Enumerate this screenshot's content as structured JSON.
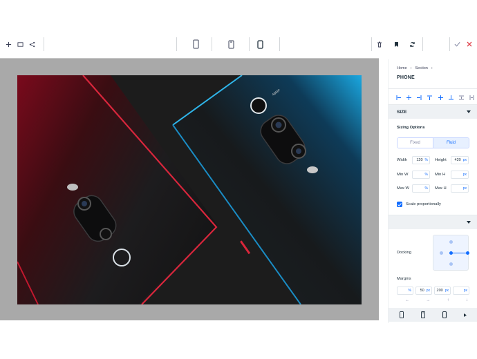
{
  "toolbar": {
    "left_icons": [
      "plus-icon",
      "square-icon",
      "share-nodes-icon"
    ],
    "device_icons": [
      "tablet-icon",
      "mobile-notch-icon",
      "mobile-icon"
    ],
    "right_icons": [
      "delete-icon",
      "bookmark-icon",
      "refresh-icon"
    ],
    "confirm_icon": "check-icon",
    "cancel_icon": "close-icon",
    "colors": {
      "cancel": "#e0454f",
      "confirm": "#868aa5"
    }
  },
  "panel": {
    "breadcrumb": [
      "Home",
      "Section"
    ],
    "title": "PHONE",
    "size_section": "SIZE",
    "sizing_options_label": "Sizing Options",
    "sizing_options": [
      "Fixed",
      "Fluid"
    ],
    "sizing_selected": "Fluid",
    "width": {
      "label": "Width",
      "value": "120",
      "unit": "%"
    },
    "height": {
      "label": "Height",
      "value": "420",
      "unit": "px"
    },
    "min_w": {
      "label": "Min W",
      "value": "",
      "unit": "%"
    },
    "min_h": {
      "label": "Min H",
      "value": "",
      "unit": "px"
    },
    "max_w": {
      "label": "Max W",
      "value": "",
      "unit": "%"
    },
    "max_h": {
      "label": "Max H",
      "value": "",
      "unit": "px"
    },
    "scale_label": "Scale proportionally",
    "scale_checked": true,
    "docking_label": "Docking",
    "margins_label": "Margins",
    "margins": [
      {
        "value": "",
        "unit": "%"
      },
      {
        "value": "50",
        "unit": "px"
      },
      {
        "value": "200",
        "unit": "px"
      },
      {
        "value": "",
        "unit": "px"
      }
    ],
    "margin_arrows": [
      "←",
      "→",
      "↑",
      "↓"
    ],
    "accent": "#116dff"
  }
}
